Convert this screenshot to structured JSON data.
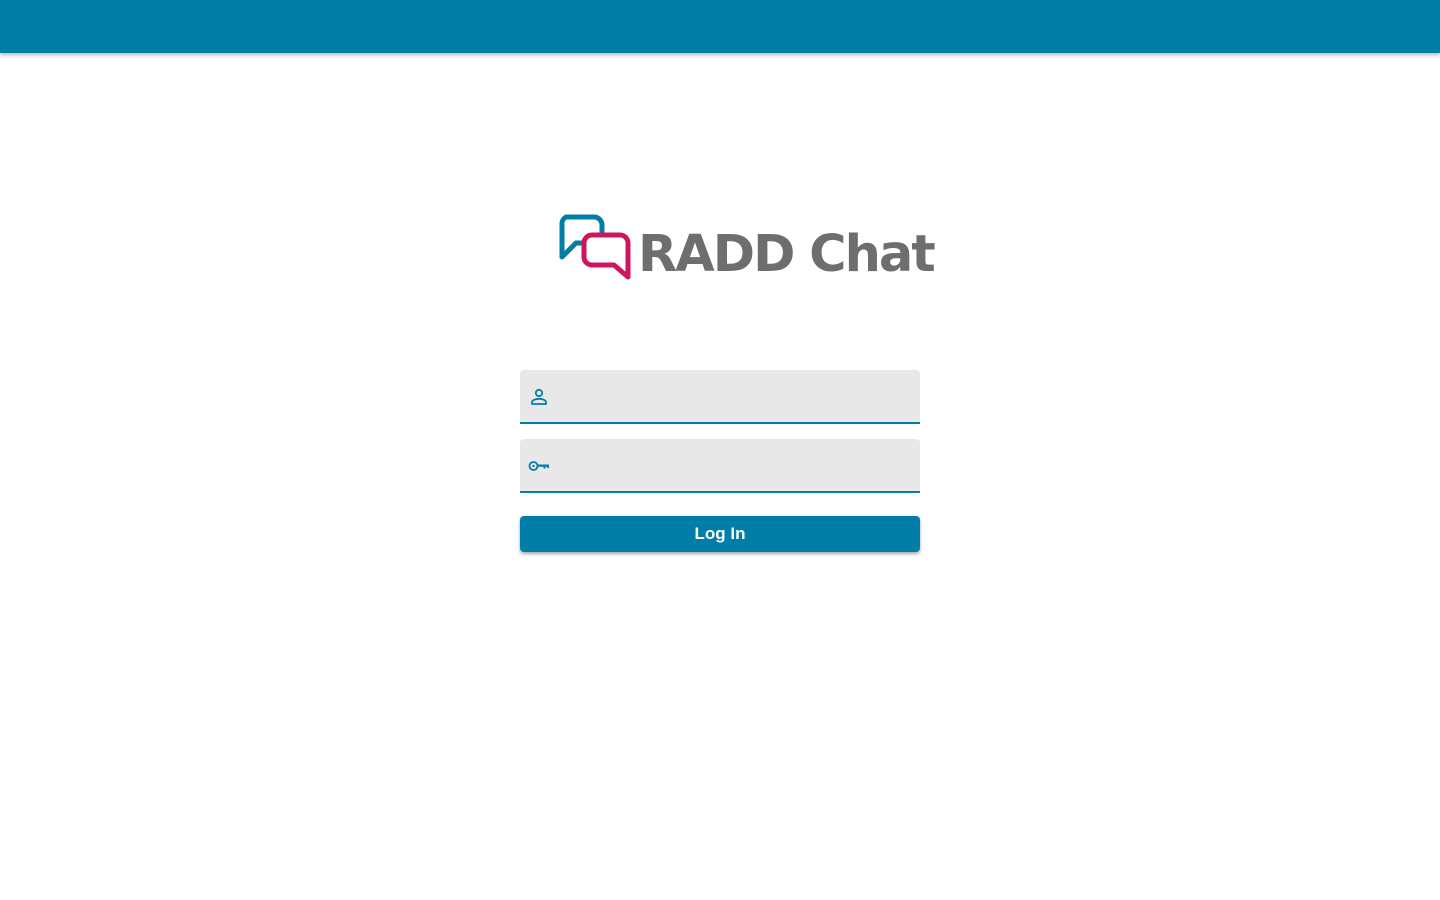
{
  "header": {
    "color": "#007ea7"
  },
  "logo": {
    "wordmark": "RADD Chat",
    "colors": {
      "bubble_back": "#007ea7",
      "bubble_front": "#d0155f",
      "text": "#6d6e70"
    }
  },
  "login_form": {
    "username": {
      "icon": "person-icon",
      "value": "",
      "placeholder": ""
    },
    "password": {
      "icon": "key-icon",
      "value": "",
      "placeholder": ""
    },
    "submit_label": "Log In"
  },
  "theme": {
    "accent": "#007ea7",
    "field_background": "#e8e8e8"
  }
}
